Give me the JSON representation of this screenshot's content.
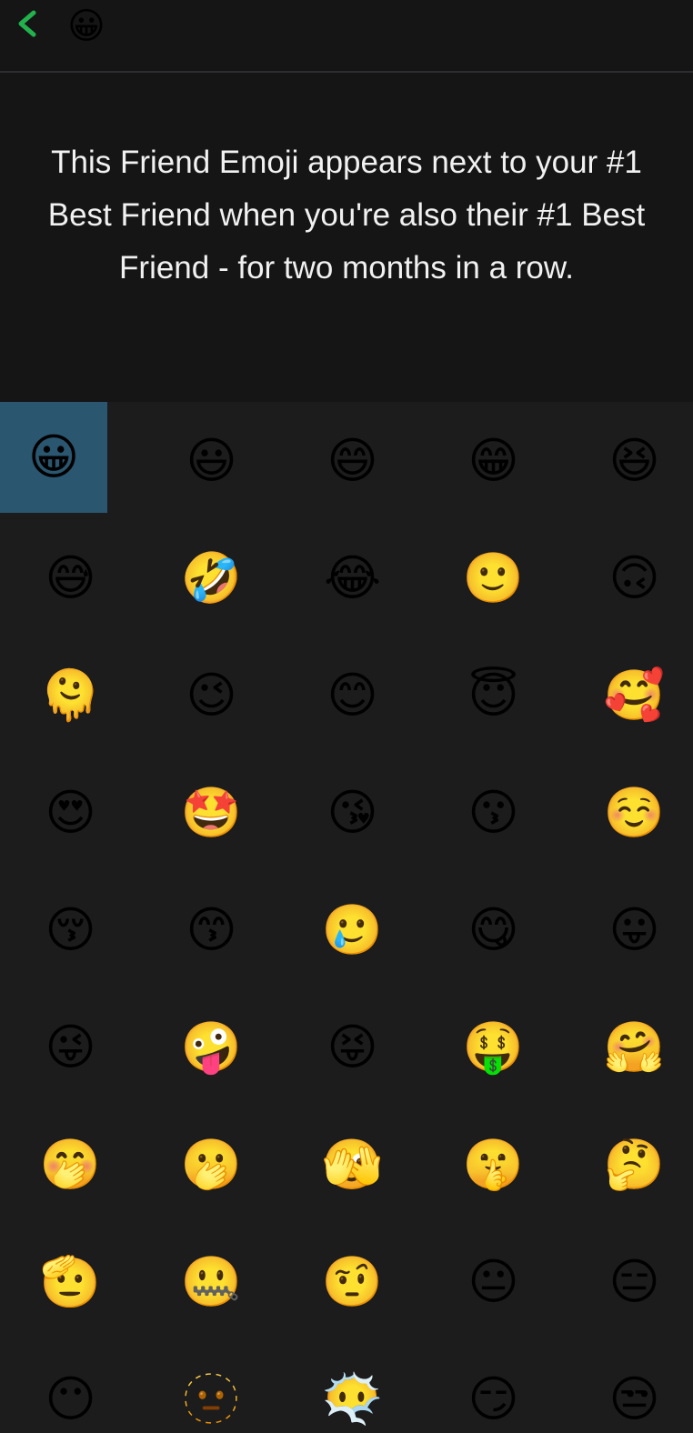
{
  "header": {
    "back_icon": "chevron-left-icon",
    "accent_color": "#22b14c",
    "current_emoji": "😀"
  },
  "description": {
    "text": "This Friend Emoji appears next to your #1 Best Friend when you're also their #1 Best Friend - for two months in a row."
  },
  "selection": {
    "selected_index": 0,
    "highlight_color": "#2a5670"
  },
  "emojis": [
    "😀",
    "😃",
    "😄",
    "😁",
    "😆",
    "😅",
    "🤣",
    "😂",
    "🙂",
    "🙃",
    "🫠",
    "😉",
    "😊",
    "😇",
    "🥰",
    "😍",
    "🤩",
    "😘",
    "😗",
    "☺️",
    "😚",
    "😙",
    "🥲",
    "😋",
    "😛",
    "😜",
    "🤪",
    "😝",
    "🤑",
    "🤗",
    "🤭",
    "🫢",
    "🫣",
    "🤫",
    "🤔",
    "🫡",
    "🤐",
    "🤨",
    "😐",
    "😑",
    "😶",
    "🫥",
    "😶‍🌫️",
    "😏",
    "😒"
  ]
}
